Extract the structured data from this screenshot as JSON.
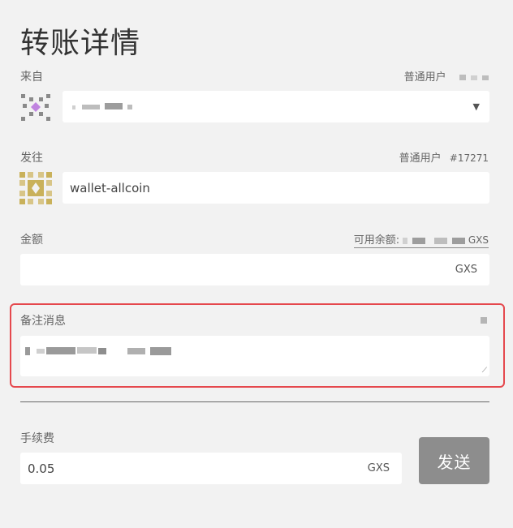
{
  "title": "转账详情",
  "from": {
    "label": "来自",
    "account_type": "普通用户",
    "dropdown_icon": "caret-down-icon"
  },
  "to": {
    "label": "发往",
    "account_type": "普通用户",
    "account_id": "#17271",
    "value": "wallet-allcoin"
  },
  "amount": {
    "label": "金额",
    "available_label": "可用余额:",
    "currency": "GXS"
  },
  "memo": {
    "label": "备注消息",
    "resize_icon": "resize-handle-icon"
  },
  "fee": {
    "label": "手续费",
    "value": "0.05",
    "currency": "GXS"
  },
  "send_button": "发送",
  "colors": {
    "highlight": "#e5484d",
    "button": "#8d8d8d",
    "background": "#f2f2f2"
  }
}
